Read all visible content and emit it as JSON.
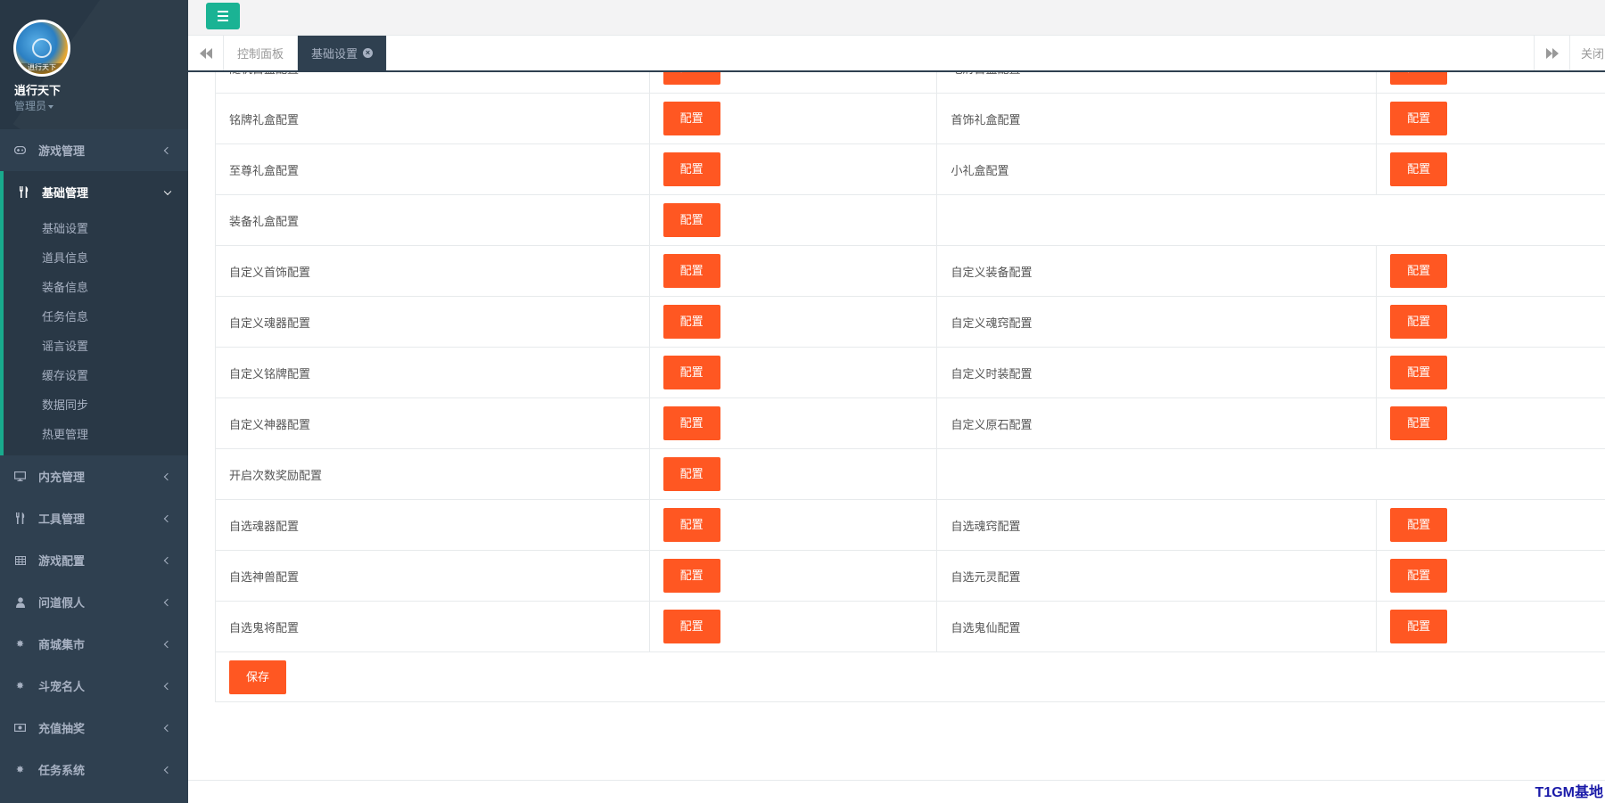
{
  "user": {
    "name": "逍行天下",
    "role": "管理员",
    "avatar_caption": "逍行天下"
  },
  "nav": [
    {
      "label": "游戏管理",
      "icon": "gamepad-icon"
    },
    {
      "label": "基础管理",
      "icon": "cutlery-icon",
      "active": true
    },
    {
      "label": "内充管理",
      "icon": "monitor-icon"
    },
    {
      "label": "工具管理",
      "icon": "cutlery-icon"
    },
    {
      "label": "游戏配置",
      "icon": "table-icon"
    },
    {
      "label": "问道假人",
      "icon": "user-icon"
    },
    {
      "label": "商城集市",
      "icon": "gear-icon"
    },
    {
      "label": "斗宠名人",
      "icon": "gear-icon"
    },
    {
      "label": "充值抽奖",
      "icon": "money-icon"
    },
    {
      "label": "任务系统",
      "icon": "gear-icon"
    }
  ],
  "subnav": [
    "基础设置",
    "道具信息",
    "装备信息",
    "任务信息",
    "谣言设置",
    "缓存设置",
    "数据同步",
    "热更管理"
  ],
  "tabs": {
    "home": "控制面板",
    "current": "基础设置",
    "close_all": "关闭"
  },
  "config_button": "配置",
  "save_button": "保存",
  "rows": [
    [
      "随机首盒配置",
      "地府首盒配置"
    ],
    [
      "铭牌礼盒配置",
      "首饰礼盒配置"
    ],
    [
      "至尊礼盒配置",
      "小礼盒配置"
    ],
    [
      "装备礼盒配置",
      ""
    ],
    [
      "自定义首饰配置",
      "自定义装备配置"
    ],
    [
      "自定义魂器配置",
      "自定义魂窍配置"
    ],
    [
      "自定义铭牌配置",
      "自定义时装配置"
    ],
    [
      "自定义神器配置",
      "自定义原石配置"
    ],
    [
      "开启次数奖励配置",
      ""
    ],
    [
      "自选魂器配置",
      "自选魂窍配置"
    ],
    [
      "自选神兽配置",
      "自选元灵配置"
    ],
    [
      "自选鬼将配置",
      "自选鬼仙配置"
    ]
  ],
  "footer_brand": "T1GM基地",
  "colors": {
    "sidebar": "#2f4050",
    "accent": "#1ab394",
    "button": "#ff5722"
  }
}
